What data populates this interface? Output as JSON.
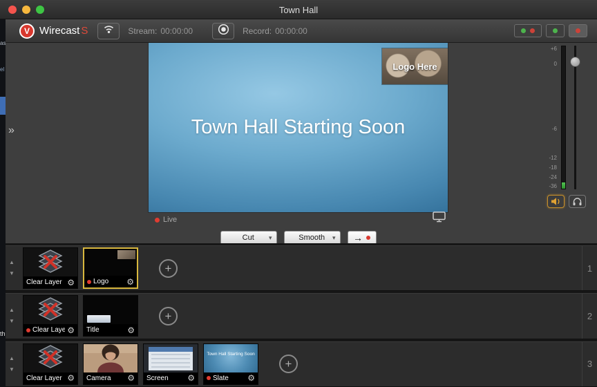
{
  "window": {
    "title": "Town Hall"
  },
  "toolbar": {
    "brand": "Wirecast",
    "brand_suffix": "S",
    "stream_label": "Stream:",
    "stream_time": "00:00:00",
    "record_label": "Record:",
    "record_time": "00:00:00"
  },
  "preview": {
    "headline": "Town Hall Starting Soon",
    "logo_text": "Logo Here",
    "live_label": "Live"
  },
  "transition": {
    "primary": "Cut",
    "secondary": "Smooth"
  },
  "audio": {
    "ticks": [
      "+6",
      "0",
      "-6",
      "-12",
      "-18",
      "-24",
      "-36"
    ]
  },
  "layers": {
    "rows": [
      {
        "number": "1",
        "shots": [
          {
            "label": "Clear Layer",
            "live": false,
            "selected": false
          },
          {
            "label": "Logo",
            "live": true,
            "selected": true
          }
        ]
      },
      {
        "number": "2",
        "shots": [
          {
            "label": "Clear Layer",
            "live": true,
            "selected": false
          },
          {
            "label": "Title",
            "live": false,
            "selected": false
          }
        ]
      },
      {
        "number": "3",
        "shots": [
          {
            "label": "Clear Layer",
            "live": false,
            "selected": false
          },
          {
            "label": "Camera",
            "live": false,
            "selected": false
          },
          {
            "label": "Screen",
            "live": false,
            "selected": false
          },
          {
            "label": "Slate",
            "live": true,
            "selected": false,
            "thumb_text": "Town Hall Starting Soon"
          }
        ]
      }
    ]
  },
  "background_fragments": [
    "as",
    "el",
    "th"
  ],
  "icons": {
    "brand_glyph": "V",
    "caret_down": "▾",
    "row_up": "▲",
    "row_down": "▼",
    "gear": "⚙",
    "plus": "+",
    "expand": "»",
    "go_arrow": "→"
  },
  "colors": {
    "accent_red": "#d93a30",
    "selection_gold": "#d8b73e",
    "live_green": "#4db34d"
  }
}
